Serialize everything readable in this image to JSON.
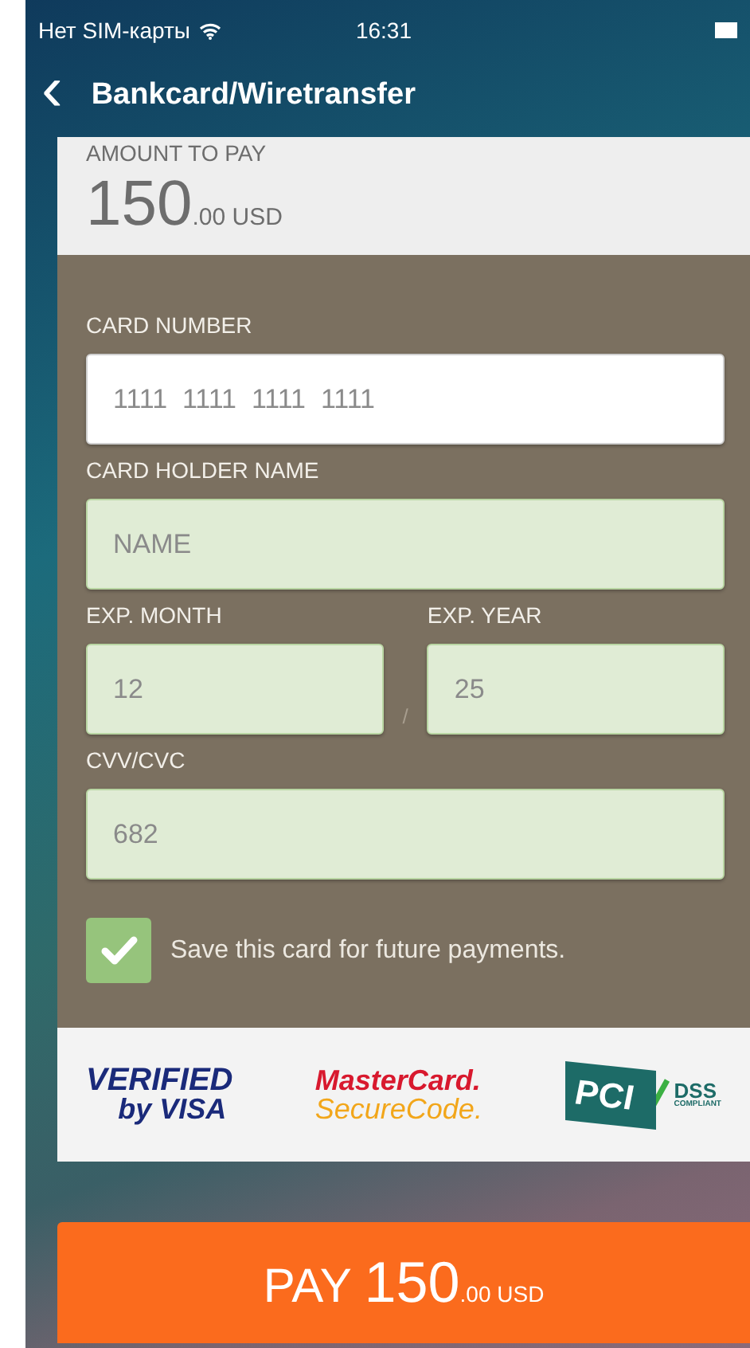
{
  "status_bar": {
    "carrier": "Нет SIM-карты",
    "time": "16:31"
  },
  "nav": {
    "back": "‹",
    "title": "Bankcard/Wiretransfer"
  },
  "amount": {
    "label": "AMOUNT TO PAY",
    "whole": "150",
    "fraction": ".00 USD"
  },
  "form": {
    "fields": [
      {
        "label": "CARD NUMBER",
        "placeholder": "1111  1111  1111  1111",
        "valid": false,
        "kind": "full"
      },
      {
        "label": "CARD HOLDER NAME",
        "placeholder": "NAME",
        "valid": true,
        "kind": "full"
      },
      {
        "label": "EXP. MONTH",
        "placeholder": "12",
        "valid": true,
        "kind": "half"
      },
      {
        "label": "EXP. YEAR",
        "placeholder": "25",
        "valid": true,
        "kind": "half"
      },
      {
        "label": "CVV/CVC",
        "placeholder": "682",
        "valid": true,
        "kind": "full"
      }
    ],
    "separator": "/",
    "save_card": {
      "label": "Save this card for future payments.",
      "checked": true
    }
  },
  "logos": [
    {
      "kind": "visa",
      "lines": [
        "VERIFIED",
        "by VISA"
      ]
    },
    {
      "kind": "mastercard",
      "lines": [
        "MasterCard.",
        "SecureCode."
      ]
    },
    {
      "kind": "pci",
      "lines": [
        "PCI",
        "DSS",
        "COMPLIANT"
      ]
    }
  ],
  "pay_button": {
    "label": "PAY",
    "whole": "150",
    "fraction": ".00 USD"
  }
}
